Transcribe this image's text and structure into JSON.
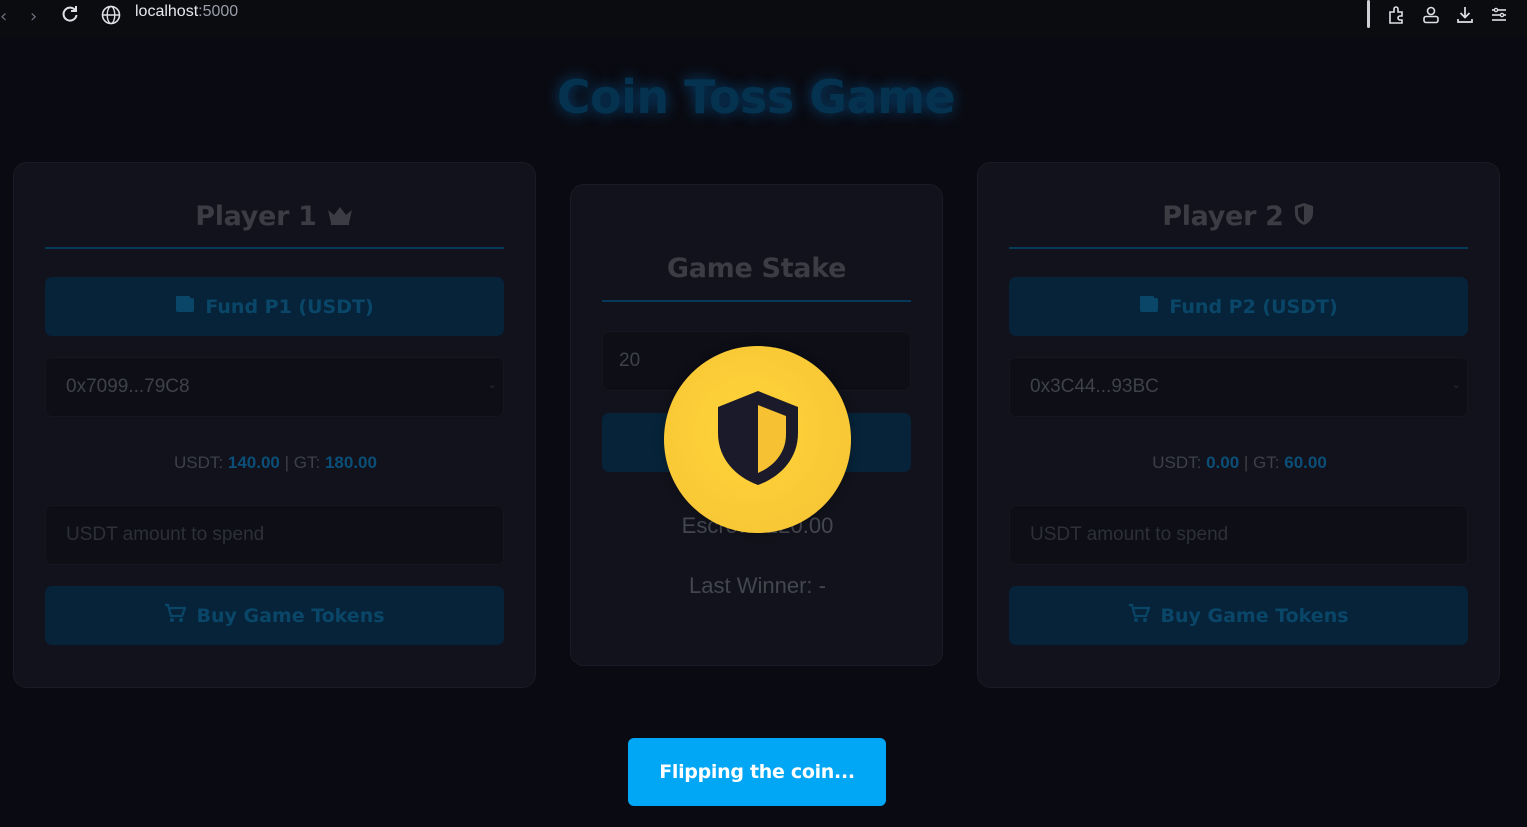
{
  "browser": {
    "url_host": "localhost",
    "url_port": ":5000"
  },
  "page": {
    "title": "Coin Toss Game"
  },
  "player1": {
    "heading": "Player 1",
    "heading_icon": "crown-icon",
    "fund_label": "Fund P1 (USDT)",
    "address": "0x7099...79C8",
    "usdt_label": "USDT:",
    "usdt_value": "140.00",
    "separator": "|",
    "gt_label": "GT:",
    "gt_value": "180.00",
    "amount_placeholder": "USDT amount to spend",
    "buy_label": "Buy Game Tokens"
  },
  "stake": {
    "heading": "Game Stake",
    "value": "20",
    "escrow_text": "Escrow: 120.00",
    "last_winner": "Last Winner: -"
  },
  "player2": {
    "heading": "Player 2",
    "heading_icon": "shield-icon",
    "fund_label": "Fund P2 (USDT)",
    "address": "0x3C44...93BC",
    "usdt_label": "USDT:",
    "usdt_value": "0.00",
    "separator": "|",
    "gt_label": "GT:",
    "gt_value": "60.00",
    "amount_placeholder": "USDT amount to spend",
    "buy_label": "Buy Game Tokens"
  },
  "overlay": {
    "coin_icon": "shield-icon",
    "status_button": "Flipping the coin..."
  },
  "colors": {
    "accent": "#01a6f4",
    "coin": "#ffd43a",
    "background": "#0a0b12"
  }
}
